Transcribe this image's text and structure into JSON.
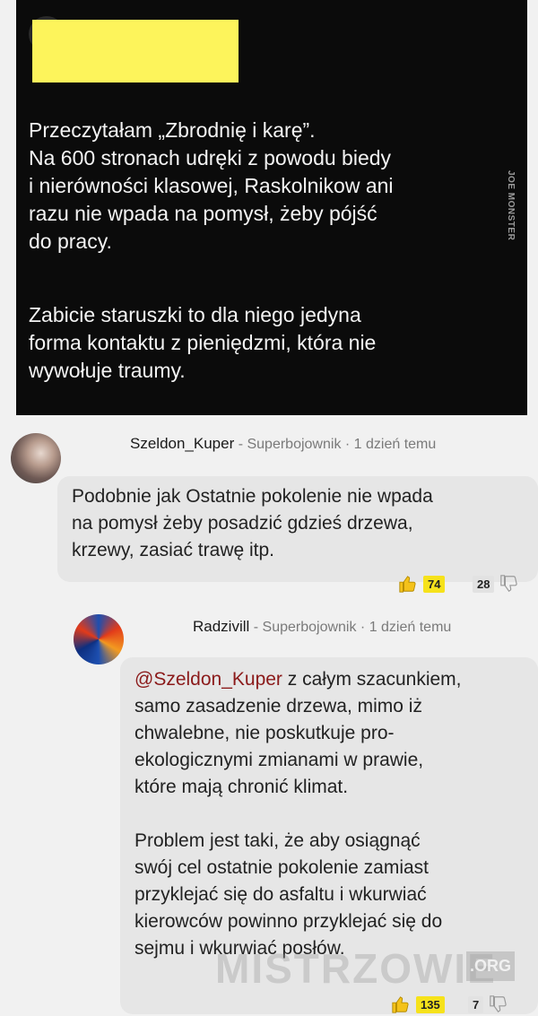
{
  "post": {
    "line1": "Przeczytałam „Zbrodnię i karę”.\nNa 600 stronach udręki z powodu biedy\ni nierówności klasowej, Raskolnikow ani\nrazu nie wpada na pomysł, żeby pójść\ndo pracy.",
    "line2": "Zabicie staruszki to dla niego jedyna\nforma kontaktu z pieniędzmi, która nie\nwywołuje traumy.",
    "watermark": "JOE MONSTER"
  },
  "comments": [
    {
      "author": "Szeldon_Kuper",
      "rank": " - Superbojownik · 1 dzień temu",
      "text": "Podobnie jak Ostatnie pokolenie nie wpada\nna pomysł żeby posadzić gdzieś drzewa,\nkrzewy, zasiać trawę itp.",
      "upvotes": "74",
      "downvotes": "28"
    },
    {
      "author": "Radzivill",
      "rank": " - Superbojownik · 1 dzień temu",
      "mention": "@Szeldon_Kuper",
      "text_after_mention": " z całym szacunkiem,\nsamo zasadzenie drzewa, mimo iż\nchwalebne, nie poskutkuje pro-\nekologicznymi zmianami w prawie,\nktóre mają chronić klimat.\n\nProblem jest taki, że aby osiągnąć\nswój cel ostatnie pokolenie zamiast\nprzyklejać się do asfaltu i wkurwiać\nkierowców powinno przyklejać się do\nsejmu i wkurwiać posłów.",
      "upvotes": "135",
      "downvotes": "7"
    }
  ],
  "site_watermark": {
    "main": "MISTRZOWIE",
    "suffix": ".ORG"
  },
  "colors": {
    "upvote_badge": "#f6e21b",
    "mention": "#8b1a1a",
    "redaction": "#fdf45b"
  }
}
